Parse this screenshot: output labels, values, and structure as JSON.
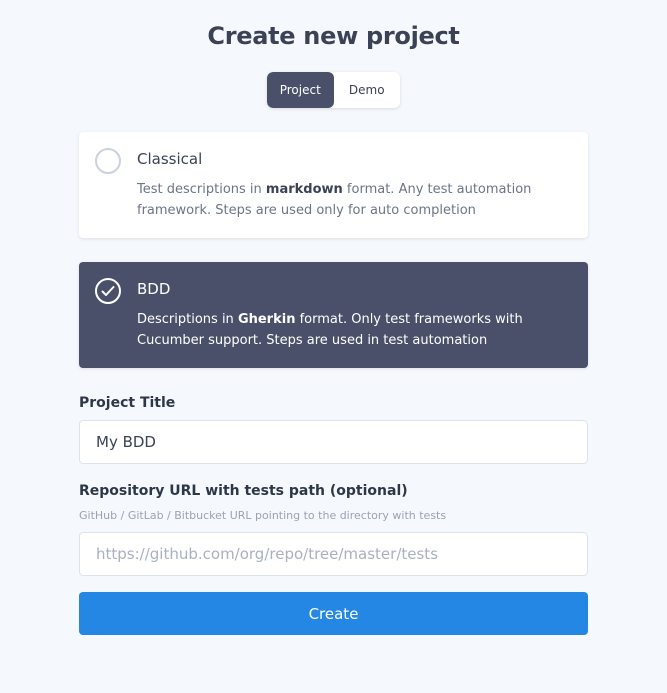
{
  "page": {
    "title": "Create new project"
  },
  "toggle": {
    "project_label": "Project",
    "demo_label": "Demo",
    "selected": "Project"
  },
  "types": [
    {
      "title": "Classical",
      "desc_before": "Test descriptions in ",
      "desc_bold": "markdown",
      "desc_after": " format. Any test automation framework. Steps are used only for auto completion",
      "selected": false
    },
    {
      "title": "BDD",
      "desc_before": "Descriptions in ",
      "desc_bold": "Gherkin",
      "desc_after": " format. Only test frameworks with Cucumber support. Steps are used in test automation",
      "selected": true
    }
  ],
  "form": {
    "project_title_label": "Project Title",
    "project_title_value": "My BDD",
    "repo_label": "Repository URL with tests path (optional)",
    "repo_hint": "GitHub / GitLab / Bitbucket URL pointing to the directory with tests",
    "repo_placeholder": "https://github.com/org/repo/tree/master/tests",
    "repo_value": "",
    "create_label": "Create"
  },
  "colors": {
    "accent": "#2387e3",
    "selected_card": "#4a5069",
    "background": "#f5f8fc"
  }
}
